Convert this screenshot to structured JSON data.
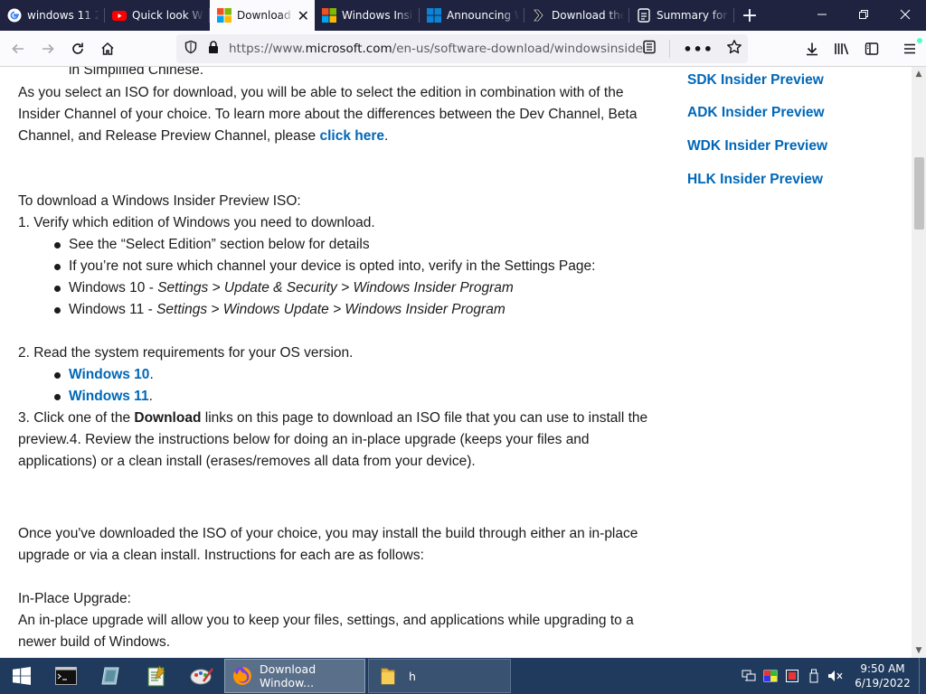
{
  "tabs": [
    {
      "title": "windows 11 2",
      "icon": "google-icon",
      "active": false
    },
    {
      "title": "Quick look Wi",
      "icon": "youtube-icon",
      "active": false
    },
    {
      "title": "Download",
      "icon": "microsoft-icon",
      "active": true
    },
    {
      "title": "Windows Insi",
      "icon": "microsoft-icon",
      "active": false
    },
    {
      "title": "Announcing W",
      "icon": "windows-blog-icon",
      "active": false
    },
    {
      "title": "Download the",
      "icon": "winaero-icon",
      "active": false
    },
    {
      "title": "Summary for",
      "icon": "document-icon",
      "active": false
    }
  ],
  "navbar": {
    "url_prefix": "https://www.",
    "url_host": "microsoft.com",
    "url_path": "/en-us/software-download/windowsinsiderpreview"
  },
  "content": {
    "line0": "in Simplified Chinese.",
    "p1": {
      "l1": "As you select an ISO for download, you will be able to select the edition in combination with of the",
      "l2": "Insider Channel of your choice. To learn more about the differences between the Dev Channel, Beta",
      "l3a": "Channel, and Release Preview Channel, please ",
      "l3link": "click here",
      "l3b": "."
    },
    "steps_intro": "To download a Windows Insider Preview ISO:",
    "step1": "1. Verify which edition of Windows you need to download.",
    "b1": "See the “Select Edition” section below for details",
    "b2": "If you’re not sure which channel your device is opted into, verify in the Settings Page:",
    "b3a": "Windows 10 - ",
    "b3b": "Settings > Update & Security > Windows Insider Program",
    "b4a": "Windows 11 - ",
    "b4b": "Settings > Windows Update > Windows Insider Program",
    "step2": "2. Read the system requirements for your OS version.",
    "req1": "Windows 10",
    "req2": "Windows 11",
    "dot": ".",
    "step3a": "3. Click one of the ",
    "step3b": "Download",
    "step3c": " links on this page to download an ISO file that you can use to install the",
    "step3d": "preview.4. Review the instructions below for doing an in-place upgrade (keeps your files and",
    "step3e": "applications) or a clean install (erases/removes all data from your device).",
    "once1": "Once you've downloaded the ISO of your choice, you may install the build through either an in-place",
    "once2": "upgrade or via a clean install. Instructions for each are as follows:",
    "inplace_title": "In-Place Upgrade:",
    "inplace1": "An in-place upgrade will allow you to keep your files, settings, and applications while upgrading to a",
    "inplace2": "newer build of Windows."
  },
  "sidebar": {
    "links": [
      "SDK Insider Preview",
      "ADK Insider Preview",
      "WDK Insider Preview",
      "HLK Insider Preview"
    ]
  },
  "taskbar": {
    "apps": [
      {
        "label": "Download Window...",
        "icon": "firefox-icon",
        "active": true
      },
      {
        "label": "h",
        "icon": "folder-icon",
        "active": false
      }
    ],
    "time": "9:50 AM",
    "date": "6/19/2022"
  },
  "colors": {
    "link": "#0067b8",
    "tabstrip": "#202340",
    "taskbar": "#1f3a5c"
  }
}
